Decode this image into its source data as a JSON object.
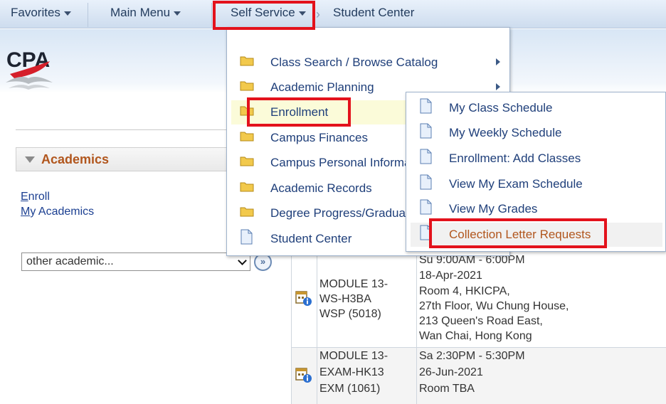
{
  "navbar": {
    "favorites": "Favorites",
    "main_menu": "Main Menu",
    "self_service": "Self Service",
    "breadcrumb_current": "Student Center"
  },
  "logo": {
    "text": "CPA",
    "colors": {
      "red": "#d51f2a",
      "gray": "#9ea3a8"
    }
  },
  "academics": {
    "title": "Academics",
    "links": [
      "Enroll",
      "My Academics"
    ],
    "select": {
      "selected": "other academic...",
      "go_label": "»"
    }
  },
  "self_service_menu": {
    "items": [
      {
        "label": "Class Search / Browse Catalog",
        "icon": "folder-icon",
        "has_submenu": true
      },
      {
        "label": "Academic Planning",
        "icon": "folder-icon",
        "has_submenu": true
      },
      {
        "label": "Enrollment",
        "icon": "folder-icon",
        "has_submenu": true,
        "highlighted": true
      },
      {
        "label": "Campus Finances",
        "icon": "folder-icon",
        "has_submenu": false
      },
      {
        "label": "Campus Personal Informa",
        "icon": "folder-icon",
        "has_submenu": false
      },
      {
        "label": "Academic Records",
        "icon": "folder-icon",
        "has_submenu": false
      },
      {
        "label": "Degree Progress/Graduat",
        "icon": "folder-icon",
        "has_submenu": false
      },
      {
        "label": "Student Center",
        "icon": "document-icon",
        "has_submenu": false
      }
    ]
  },
  "enrollment_submenu": {
    "items": [
      {
        "label": "My Class Schedule",
        "icon": "document-icon"
      },
      {
        "label": "My Weekly Schedule",
        "icon": "document-icon"
      },
      {
        "label": "Enrollment: Add Classes",
        "icon": "document-icon"
      },
      {
        "label": "View My Exam Schedule",
        "icon": "document-icon"
      },
      {
        "label": "View My Grades",
        "icon": "document-icon"
      },
      {
        "label": "Collection Letter Requests",
        "icon": "document-icon",
        "highlighted": true
      }
    ]
  },
  "schedule": {
    "rows": [
      {
        "class_lines": [
          "MODULE 13-",
          "WS-H3BA",
          "WSP (5018)"
        ],
        "detail_lines": [
          "Su 9:00AM - 6:00PM",
          "18-Apr-2021",
          "Room 4, HKICPA,",
          "27th Floor, Wu Chung House,",
          "213 Queen's Road East,",
          "Wan Chai, Hong Kong"
        ]
      },
      {
        "class_lines": [
          "MODULE 13-",
          "EXAM-HK13",
          "EXM (1061)"
        ],
        "detail_lines": [
          "Sa 2:30PM - 5:30PM",
          "26-Jun-2021",
          "Room  TBA"
        ]
      }
    ]
  },
  "colors": {
    "highlight_box": "#e3121c",
    "link": "#1f3f7a",
    "accent_orange": "#b1561d"
  }
}
